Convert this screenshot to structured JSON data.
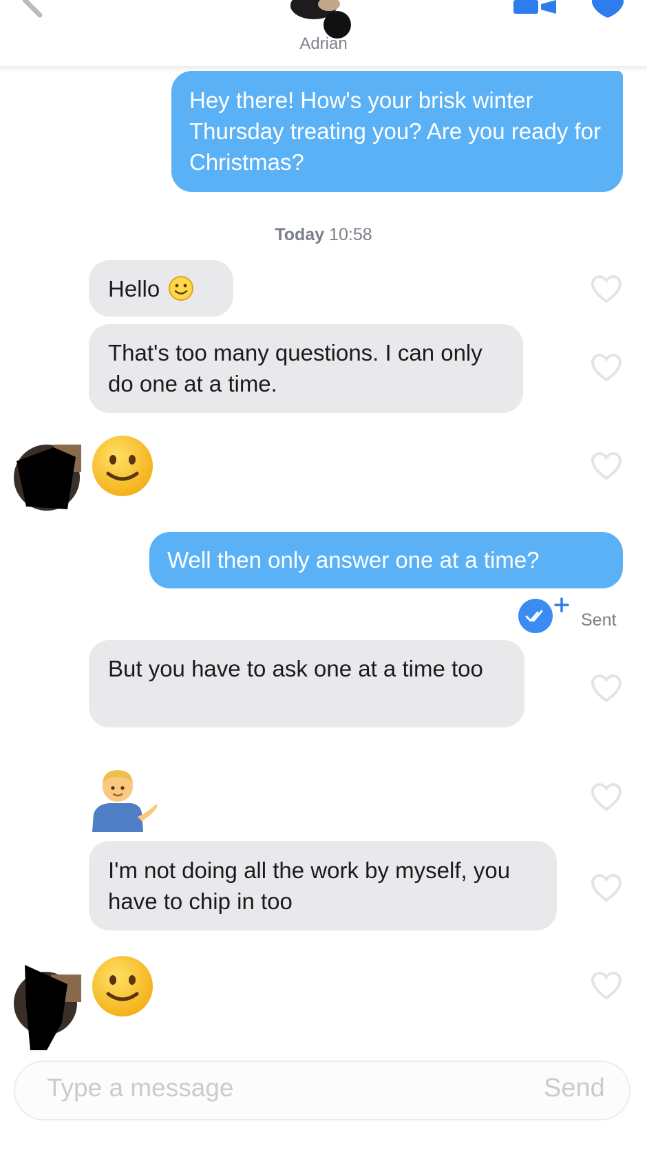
{
  "header": {
    "match_name": "Adrian",
    "icons": [
      "back-icon",
      "match-avatar",
      "video-call-icon",
      "safety-shield-icon"
    ]
  },
  "messages": [
    {
      "id": 1,
      "direction": "outgoing",
      "text": "Hey there! How's your brisk winter Thursday treating you? Are you ready for Christmas?"
    },
    {
      "id": 2,
      "direction": "incoming",
      "text": "Hello",
      "emoji": "slightly-smiling-face"
    },
    {
      "id": 3,
      "direction": "incoming",
      "text": "That's too many questions.  I can only do one at a time."
    },
    {
      "id": 4,
      "direction": "incoming",
      "emoji": "slightly-smiling-face"
    },
    {
      "id": 5,
      "direction": "outgoing",
      "text": "Well then only answer one at a time?"
    },
    {
      "id": 6,
      "direction": "incoming",
      "text": "But you have to ask one at a time too"
    },
    {
      "id": 7,
      "direction": "incoming",
      "emoji": "person-tipping-hand"
    },
    {
      "id": 8,
      "direction": "incoming",
      "text": "I'm not doing all the work by myself, you have to chip in too"
    },
    {
      "id": 9,
      "direction": "incoming",
      "emoji": "slightly-smiling-face"
    }
  ],
  "timestamp": {
    "day": "Today",
    "time": "10:58"
  },
  "status": {
    "sent_label": "Sent"
  },
  "composer": {
    "placeholder": "Type a message",
    "send_label": "Send"
  },
  "colors": {
    "outgoing_bubble": "#5ab1f6",
    "incoming_bubble": "#e9e9eb",
    "read_badge": "#3a8cf2",
    "muted_text": "#7a7f88"
  }
}
